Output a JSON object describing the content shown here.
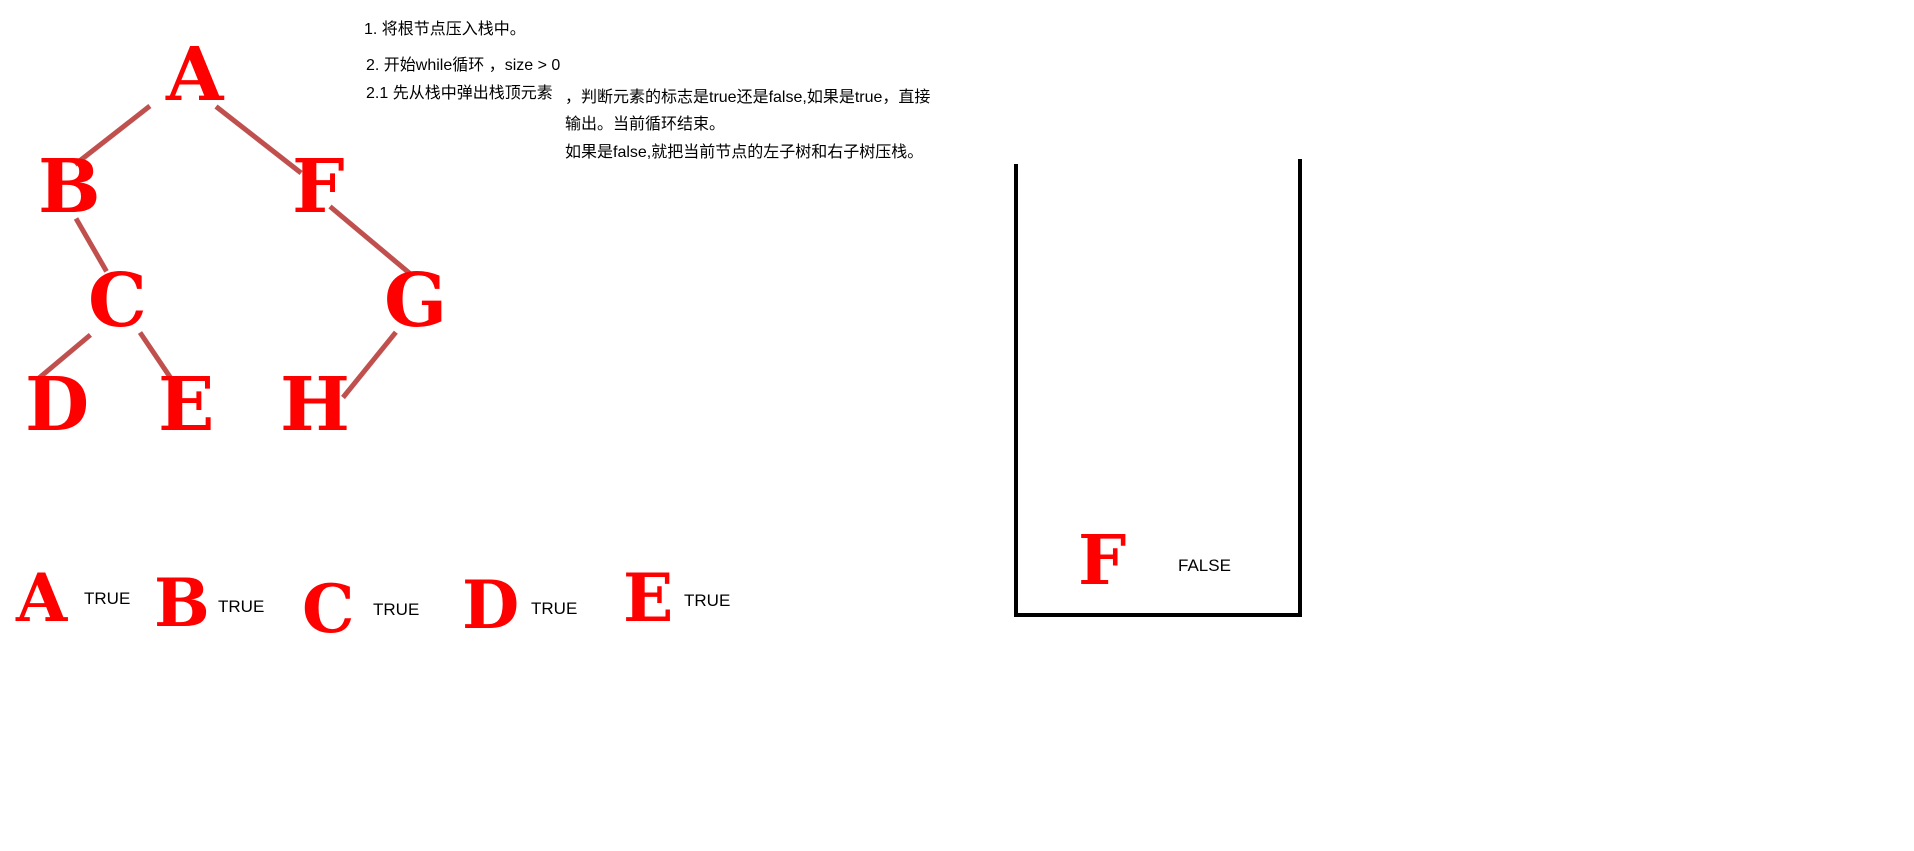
{
  "tree": {
    "nodes": {
      "A": "A",
      "B": "B",
      "C": "C",
      "D": "D",
      "E": "E",
      "F": "F",
      "G": "G",
      "H": "H"
    }
  },
  "steps": {
    "step1": "1. 将根节点压入栈中。",
    "step2": "2. 开始while循环 ，size > 0",
    "step2_1": "2.1 先从栈中弹出栈顶元素",
    "step2_1_cont_line1": "，判断元素的标志是true还是false,如果是true，直接",
    "step2_1_cont_line2": "输出。当前循环结束。",
    "step2_1_cont_line3": "如果是false,就把当前节点的左子树和右子树压栈。"
  },
  "output": [
    {
      "letter": "A",
      "flag": "TRUE"
    },
    {
      "letter": "B",
      "flag": "TRUE"
    },
    {
      "letter": "C",
      "flag": "TRUE"
    },
    {
      "letter": "D",
      "flag": "TRUE"
    },
    {
      "letter": "E",
      "flag": "TRUE"
    }
  ],
  "stack": {
    "items": [
      {
        "letter": "F",
        "flag": "FALSE"
      }
    ]
  },
  "colors": {
    "node": "#ff0000",
    "edge": "#c0504d",
    "stack_wall": "#000000"
  }
}
